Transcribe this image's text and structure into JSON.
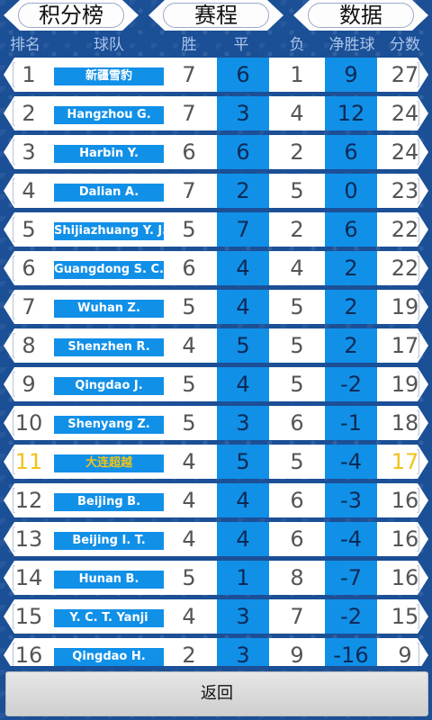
{
  "tabs": [
    "积分榜",
    "赛程",
    "数据"
  ],
  "columns": [
    "排名",
    "球队",
    "胜",
    "平",
    "负",
    "净胜球",
    "分数"
  ],
  "highlight_color": "#f0c419",
  "accent_color": "#1190e8",
  "standings": [
    {
      "rank": "1",
      "team": "新疆雪豹",
      "w": "7",
      "d": "6",
      "l": "1",
      "gd": "9",
      "pts": "27"
    },
    {
      "rank": "2",
      "team": "Hangzhou G.",
      "w": "7",
      "d": "3",
      "l": "4",
      "gd": "12",
      "pts": "24"
    },
    {
      "rank": "3",
      "team": "Harbin Y.",
      "w": "6",
      "d": "6",
      "l": "2",
      "gd": "6",
      "pts": "24"
    },
    {
      "rank": "4",
      "team": "Dalian A.",
      "w": "7",
      "d": "2",
      "l": "5",
      "gd": "0",
      "pts": "23"
    },
    {
      "rank": "5",
      "team": "Shijiazhuang Y. J.",
      "w": "5",
      "d": "7",
      "l": "2",
      "gd": "6",
      "pts": "22"
    },
    {
      "rank": "6",
      "team": "Guangdong S. C.",
      "w": "6",
      "d": "4",
      "l": "4",
      "gd": "2",
      "pts": "22"
    },
    {
      "rank": "7",
      "team": "Wuhan Z.",
      "w": "5",
      "d": "4",
      "l": "5",
      "gd": "2",
      "pts": "19"
    },
    {
      "rank": "8",
      "team": "Shenzhen R.",
      "w": "4",
      "d": "5",
      "l": "5",
      "gd": "2",
      "pts": "17"
    },
    {
      "rank": "9",
      "team": "Qingdao J.",
      "w": "5",
      "d": "4",
      "l": "5",
      "gd": "-2",
      "pts": "19"
    },
    {
      "rank": "10",
      "team": "Shenyang Z.",
      "w": "5",
      "d": "3",
      "l": "6",
      "gd": "-1",
      "pts": "18"
    },
    {
      "rank": "11",
      "team": "大连超越",
      "w": "4",
      "d": "5",
      "l": "5",
      "gd": "-4",
      "pts": "17",
      "highlight": true
    },
    {
      "rank": "12",
      "team": "Beijing B.",
      "w": "4",
      "d": "4",
      "l": "6",
      "gd": "-3",
      "pts": "16"
    },
    {
      "rank": "13",
      "team": "Beijing I. T.",
      "w": "4",
      "d": "4",
      "l": "6",
      "gd": "-4",
      "pts": "16"
    },
    {
      "rank": "14",
      "team": "Hunan B.",
      "w": "5",
      "d": "1",
      "l": "8",
      "gd": "-7",
      "pts": "16"
    },
    {
      "rank": "15",
      "team": "Y. C. T. Yanji",
      "w": "4",
      "d": "3",
      "l": "7",
      "gd": "-2",
      "pts": "15"
    },
    {
      "rank": "16",
      "team": "Qingdao H.",
      "w": "2",
      "d": "3",
      "l": "9",
      "gd": "-16",
      "pts": "9"
    }
  ],
  "back_label": "返回"
}
